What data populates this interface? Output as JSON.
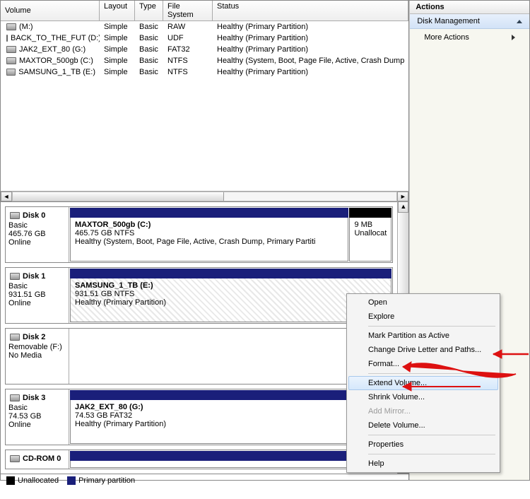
{
  "volumeHeaders": {
    "volume": "Volume",
    "layout": "Layout",
    "type": "Type",
    "fs": "File System",
    "status": "Status"
  },
  "volumes": [
    {
      "name": "(M:)",
      "layout": "Simple",
      "type": "Basic",
      "fs": "RAW",
      "status": "Healthy (Primary Partition)"
    },
    {
      "name": "BACK_TO_THE_FUT (D:)",
      "layout": "Simple",
      "type": "Basic",
      "fs": "UDF",
      "status": "Healthy (Primary Partition)"
    },
    {
      "name": "JAK2_EXT_80 (G:)",
      "layout": "Simple",
      "type": "Basic",
      "fs": "FAT32",
      "status": "Healthy (Primary Partition)"
    },
    {
      "name": "MAXTOR_500gb (C:)",
      "layout": "Simple",
      "type": "Basic",
      "fs": "NTFS",
      "status": "Healthy (System, Boot, Page File, Active, Crash Dump"
    },
    {
      "name": "SAMSUNG_1_TB (E:)",
      "layout": "Simple",
      "type": "Basic",
      "fs": "NTFS",
      "status": "Healthy (Primary Partition)"
    }
  ],
  "disks": [
    {
      "name": "Disk 0",
      "type": "Basic",
      "size": "465.76 GB",
      "state": "Online",
      "parts": [
        {
          "bar": "primary",
          "title": "MAXTOR_500gb  (C:)",
          "sub": "465.75 GB NTFS",
          "status": "Healthy (System, Boot, Page File, Active, Crash Dump, Primary Partiti",
          "grow": 9
        },
        {
          "bar": "unalloc",
          "title": "",
          "sub": "9 MB",
          "status": "Unallocat",
          "grow": 1
        }
      ]
    },
    {
      "name": "Disk 1",
      "type": "Basic",
      "size": "931.51 GB",
      "state": "Online",
      "parts": [
        {
          "bar": "primary",
          "title": "SAMSUNG_1_TB  (E:)",
          "sub": "931.51 GB NTFS",
          "status": "Healthy (Primary Partition)",
          "grow": 1,
          "hatched": true
        }
      ]
    },
    {
      "name": "Disk 2",
      "type": "Removable (F:)",
      "size": "",
      "state": "No Media",
      "parts": []
    },
    {
      "name": "Disk 3",
      "type": "Basic",
      "size": "74.53 GB",
      "state": "Online",
      "parts": [
        {
          "bar": "primary",
          "title": "JAK2_EXT_80  (G:)",
          "sub": "74.53 GB FAT32",
          "status": "Healthy (Primary Partition)",
          "grow": 1
        }
      ]
    },
    {
      "name": "CD-ROM 0",
      "type": "",
      "size": "",
      "state": "",
      "parts": [
        {
          "bar": "primary",
          "title": "",
          "sub": "",
          "status": "",
          "grow": 1
        }
      ],
      "short": true
    }
  ],
  "legend": {
    "unalloc": "Unallocated",
    "primary": "Primary partition"
  },
  "actions": {
    "header": "Actions",
    "section": "Disk Management",
    "more": "More Actions"
  },
  "context": {
    "items": [
      {
        "label": "Open",
        "sep": false
      },
      {
        "label": "Explore",
        "sep": true
      },
      {
        "label": "Mark Partition as Active",
        "sep": false
      },
      {
        "label": "Change Drive Letter and Paths...",
        "sep": false
      },
      {
        "label": "Format...",
        "sep": true
      },
      {
        "label": "Extend Volume...",
        "sep": false,
        "hover": true
      },
      {
        "label": "Shrink Volume...",
        "sep": false
      },
      {
        "label": "Add Mirror...",
        "sep": false,
        "disabled": true
      },
      {
        "label": "Delete Volume...",
        "sep": true
      },
      {
        "label": "Properties",
        "sep": true
      },
      {
        "label": "Help",
        "sep": false
      }
    ]
  }
}
